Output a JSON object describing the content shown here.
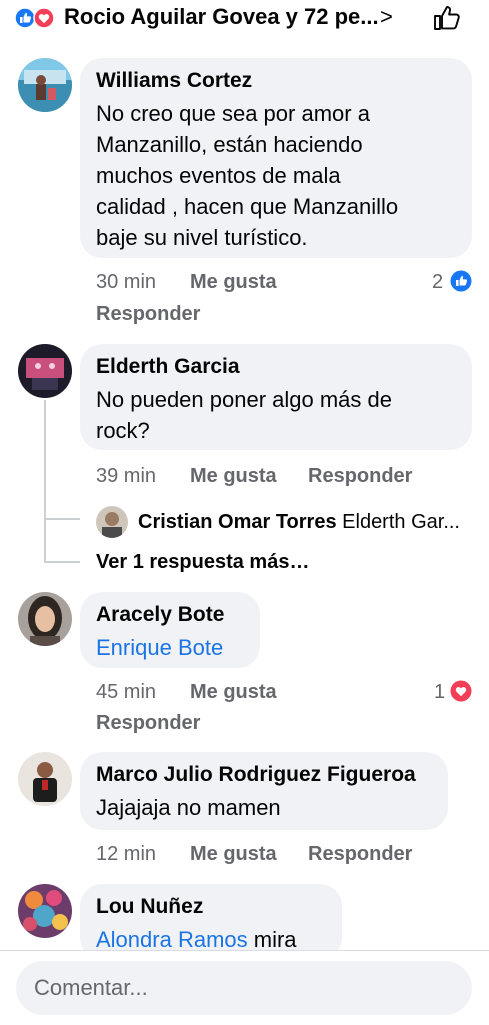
{
  "header": {
    "reactors_text": "Rocio Aguilar Govea y 72 pe...",
    "chevron": ">",
    "reaction_icons": [
      "like-icon",
      "love-icon"
    ],
    "like_icon": "thumbs-up-outline-icon"
  },
  "labels": {
    "like": "Me gusta",
    "reply": "Responder"
  },
  "comments": [
    {
      "author": "Williams Cortez",
      "lines": [
        "No creo que sea por amor a",
        "Manzanillo, están haciendo",
        "muchos eventos de mala",
        "calidad , hacen que Manzanillo",
        "baje su nivel turístico."
      ],
      "time": "30 min",
      "reaction_count": "2",
      "reaction": "like"
    },
    {
      "author": "Elderth Garcia",
      "lines": [
        "No pueden poner algo más de",
        "rock?"
      ],
      "time": "39 min",
      "reply_preview": {
        "author": "Cristian Omar Torres",
        "text": "Elderth Gar..."
      },
      "more_replies": "Ver 1 respuesta más…"
    },
    {
      "author": "Aracely Bote",
      "mention": "Enrique Bote",
      "time": "45 min",
      "reaction_count": "1",
      "reaction": "love"
    },
    {
      "author": "Marco Julio Rodriguez Figueroa",
      "lines": [
        "Jajajaja no mamen"
      ],
      "time": "12 min"
    },
    {
      "author": "Lou Nuñez",
      "mention": "Alondra Ramos",
      "text_after": " mira"
    }
  ],
  "composer": {
    "placeholder": "Comentar..."
  },
  "colors": {
    "accent": "#1b74e4",
    "like": "#1877f2",
    "love": "#f33e58",
    "bubble": "#f0f2f5",
    "meta": "#65676b"
  }
}
